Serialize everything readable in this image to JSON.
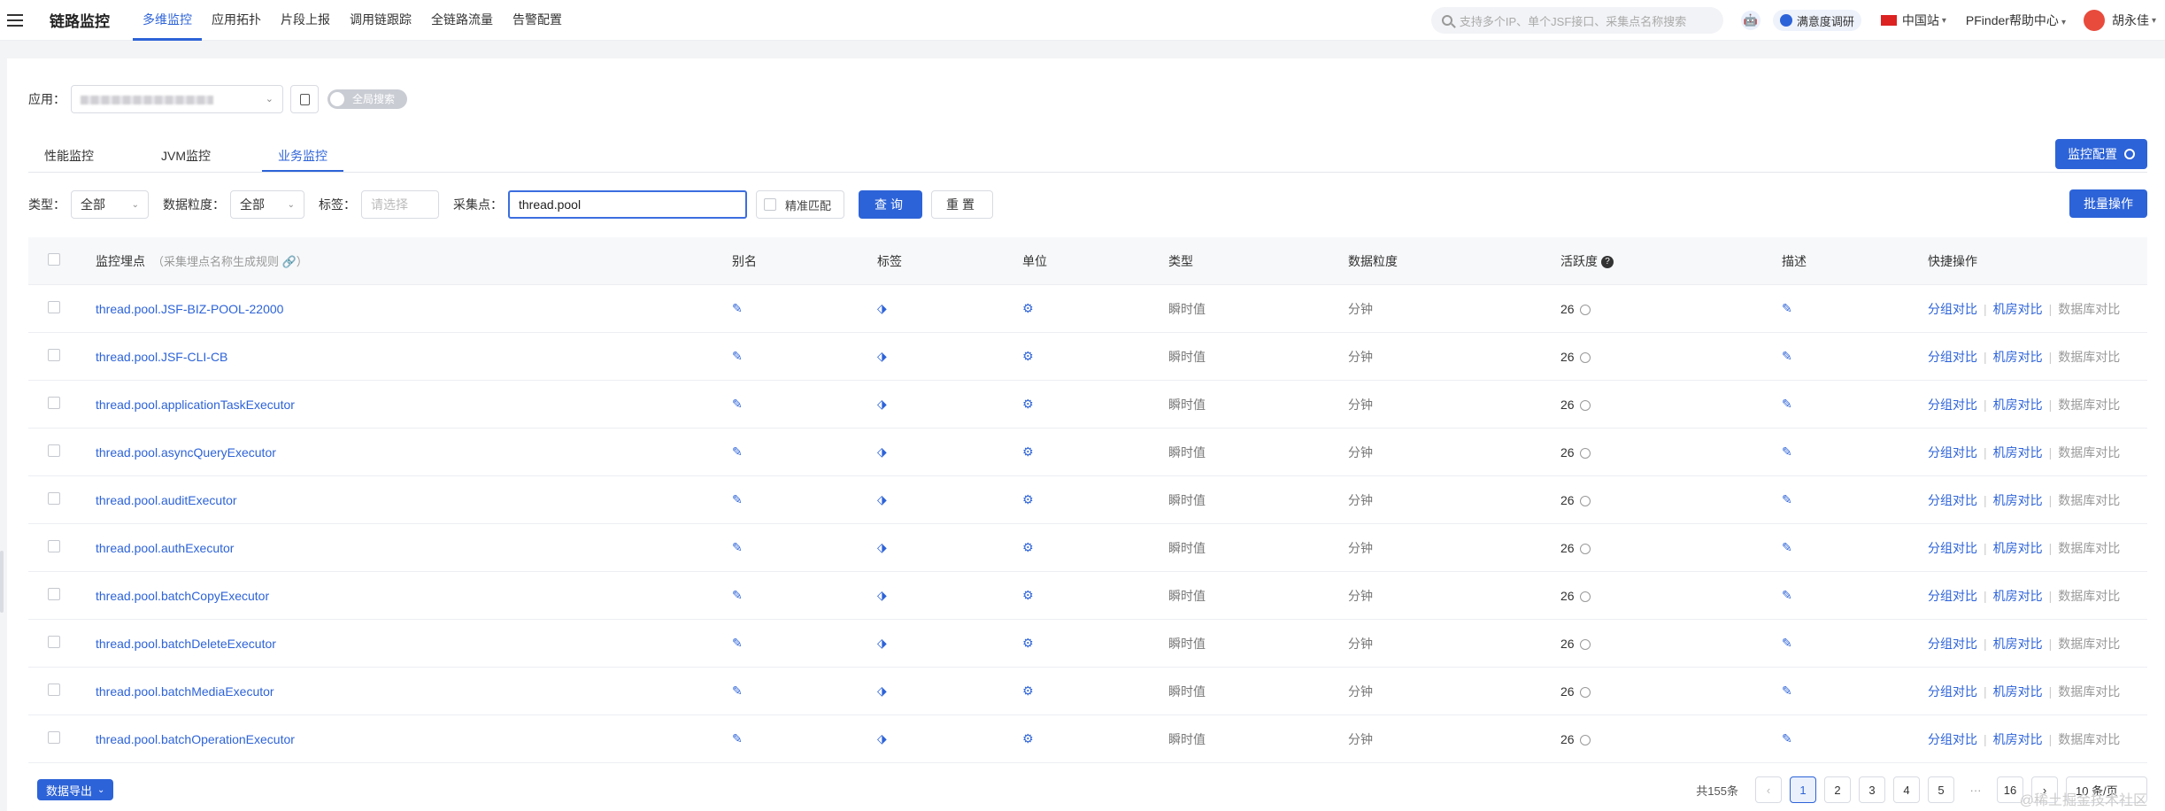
{
  "topnav": {
    "brand": "链路监控",
    "items": [
      "多维监控",
      "应用拓扑",
      "片段上报",
      "调用链跟踪",
      "全链路流量",
      "告警配置"
    ],
    "active_index": 0,
    "search_placeholder": "支持多个IP、单个JSF接口、采集点名称搜索",
    "survey": "满意度调研",
    "site": "中国站",
    "help": "PFinder帮助中心",
    "user": "胡永佳"
  },
  "filters_top": {
    "app_label": "应用：",
    "global_search": "全局搜索"
  },
  "tabs": [
    "性能监控",
    "JVM监控",
    "业务监控"
  ],
  "active_tab": 2,
  "monitor_config": "监控配置",
  "filters": {
    "type_label": "类型：",
    "type_value": "全部",
    "granularity_label": "数据粒度：",
    "granularity_value": "全部",
    "tag_label": "标签：",
    "tag_placeholder": "请选择",
    "point_label": "采集点：",
    "point_value": "thread.pool",
    "exact_match": "精准匹配",
    "query": "查询",
    "reset": "重置"
  },
  "batch_ops": "批量操作",
  "table": {
    "headers": {
      "point": "监控埋点",
      "point_hint": "（采集埋点名称生成规则 🔗）",
      "alias": "别名",
      "tag": "标签",
      "unit": "单位",
      "type": "类型",
      "granularity": "数据粒度",
      "activity": "活跃度",
      "desc": "描述",
      "ops": "快捷操作"
    },
    "rows": [
      {
        "name": "thread.pool.JSF-BIZ-POOL-22000",
        "type": "瞬时值",
        "granularity": "分钟",
        "activity": "26"
      },
      {
        "name": "thread.pool.JSF-CLI-CB",
        "type": "瞬时值",
        "granularity": "分钟",
        "activity": "26"
      },
      {
        "name": "thread.pool.applicationTaskExecutor",
        "type": "瞬时值",
        "granularity": "分钟",
        "activity": "26"
      },
      {
        "name": "thread.pool.asyncQueryExecutor",
        "type": "瞬时值",
        "granularity": "分钟",
        "activity": "26"
      },
      {
        "name": "thread.pool.auditExecutor",
        "type": "瞬时值",
        "granularity": "分钟",
        "activity": "26"
      },
      {
        "name": "thread.pool.authExecutor",
        "type": "瞬时值",
        "granularity": "分钟",
        "activity": "26"
      },
      {
        "name": "thread.pool.batchCopyExecutor",
        "type": "瞬时值",
        "granularity": "分钟",
        "activity": "26"
      },
      {
        "name": "thread.pool.batchDeleteExecutor",
        "type": "瞬时值",
        "granularity": "分钟",
        "activity": "26"
      },
      {
        "name": "thread.pool.batchMediaExecutor",
        "type": "瞬时值",
        "granularity": "分钟",
        "activity": "26"
      },
      {
        "name": "thread.pool.batchOperationExecutor",
        "type": "瞬时值",
        "granularity": "分钟",
        "activity": "26"
      }
    ],
    "ops": [
      "分组对比",
      "机房对比",
      "数据库对比"
    ]
  },
  "bottom": {
    "export": "数据导出",
    "total": "共155条",
    "pages": [
      "1",
      "2",
      "3",
      "4",
      "5",
      "···",
      "16"
    ],
    "page_size": "10 条/页",
    "watermark": "@稀土掘金技术社区"
  }
}
